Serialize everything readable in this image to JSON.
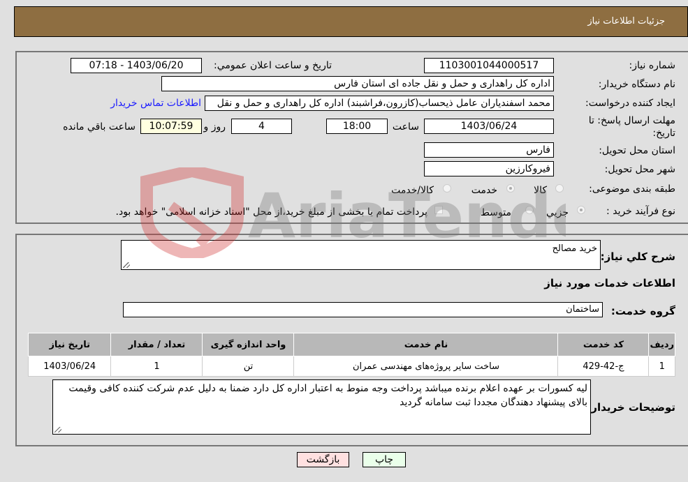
{
  "header": {
    "title": "جزئیات اطلاعات نیاز"
  },
  "need_info": {
    "need_number_label": "شماره نیاز:",
    "need_number": "1103001044000517",
    "announce_label": "تاریخ و ساعت اعلان عمومي:",
    "announce_value": "1403/06/20 - 07:18",
    "buyer_org_label": "نام دستگاه خریدار:",
    "buyer_org": "اداره کل راهداری و حمل و نقل جاده ای استان فارس",
    "creator_label": "ایجاد کننده درخواست:",
    "creator": "محمد اسفندیاران عامل ذیحساب(کازرون،فراشبند) اداره کل راهداری و حمل و نقل",
    "contact_link": "اطلاعات تماس خریدار",
    "deadline_label_line1": "مهلت ارسال پاسخ: تا",
    "deadline_label_line2": "تاریخ:",
    "deadline_date": "1403/06/24",
    "time_label": "ساعت",
    "deadline_time": "18:00",
    "days_value": "4",
    "days_label": "روز و",
    "remaining_time": "10:07:59",
    "remaining_label": "ساعت باقي مانده",
    "province_label": "استان محل تحویل:",
    "province": "فارس",
    "city_label": "شهر محل تحویل:",
    "city": "فیروکارزین",
    "category_label": "طبقه بندی موضوعی:",
    "category_options": [
      {
        "label": "کالا",
        "checked": false
      },
      {
        "label": "خدمت",
        "checked": true
      },
      {
        "label": "کالا/خدمت",
        "checked": false
      }
    ],
    "process_label": "نوع فرآیند خرید :",
    "process_options": [
      {
        "label": "جزيي",
        "checked": true
      },
      {
        "label": "متوسط",
        "checked": false
      }
    ],
    "treasury_checkbox_label": "پرداخت تمام یا بخشی از مبلغ خرید،از محل \"اسناد خزانه اسلامی\" خواهد بود.",
    "treasury_checked": false
  },
  "details": {
    "general_desc_label": "شرح کلي نیاز:",
    "general_desc": "خرید مصالح",
    "services_heading": "اطلاعات خدمات مورد نیاز",
    "service_group_label": "گروه خدمت:",
    "service_group": "ساختمان",
    "table": {
      "headers": [
        "ردیف",
        "کد خدمت",
        "نام خدمت",
        "واحد اندازه گیری",
        "تعداد / مقدار",
        "تاریخ نیاز"
      ],
      "rows": [
        [
          "1",
          "ج-42-429",
          "ساخت سایر پروژه‌های مهندسی عمران",
          "تن",
          "1",
          "1403/06/24"
        ]
      ]
    },
    "buyer_notes_label": "توضیحات خریدار:",
    "buyer_notes": "لیه کسورات بر عهده اعلام برنده میباشد پرداخت وجه منوط به اعتبار اداره کل دارد ضمنا به دلیل عدم شرکت کننده کافی وقیمت بالای پیشنهاد دهندگان مجددا ثبت سامانه گردید"
  },
  "buttons": {
    "print": "چاپ",
    "back": "بازگشت"
  },
  "watermark": {
    "text": "AriaTender.neT"
  },
  "colors": {
    "header_bg": "#8e6e41",
    "print_bg": "#eaffea",
    "back_bg": "#ffe0e0",
    "link": "#1a1aff"
  }
}
